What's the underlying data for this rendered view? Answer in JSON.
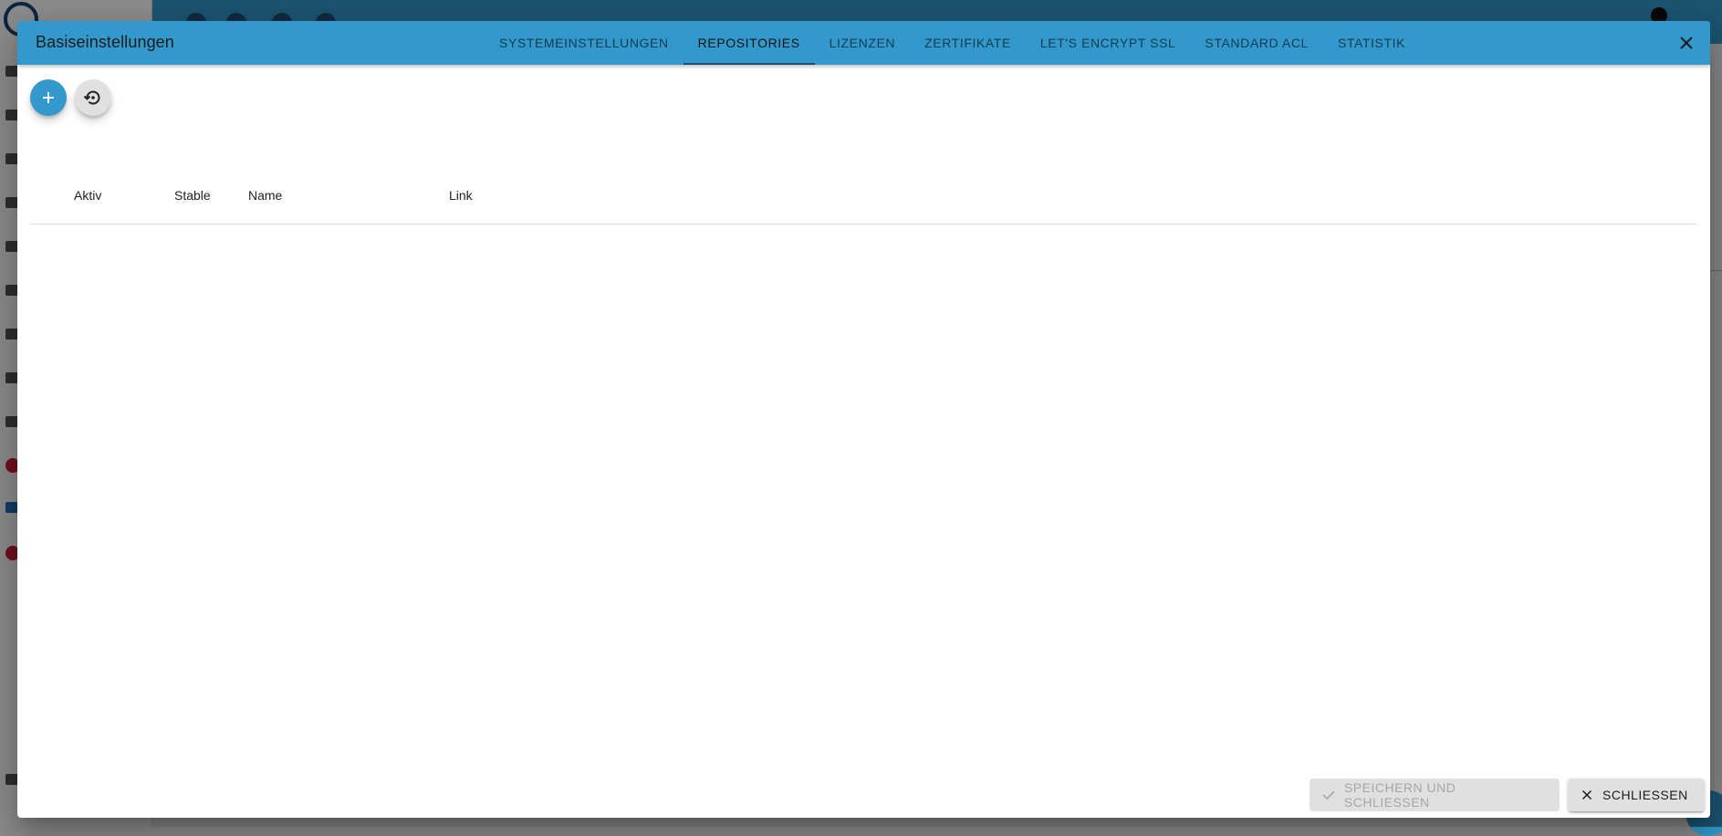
{
  "dialog": {
    "title": "Basiseinstellungen",
    "tabs": [
      {
        "label": "SYSTEMEINSTELLUNGEN"
      },
      {
        "label": "REPOSITORIES"
      },
      {
        "label": "LIZENZEN"
      },
      {
        "label": "ZERTIFIKATE"
      },
      {
        "label": "LET'S ENCRYPT SSL"
      },
      {
        "label": "STANDARD ACL"
      },
      {
        "label": "STATISTIK"
      }
    ],
    "active_tab": "REPOSITORIES",
    "accent_color": "#3399cc"
  },
  "table": {
    "columns": [
      "Aktiv",
      "Stable",
      "Name",
      "Link"
    ],
    "rows": []
  },
  "footer": {
    "save_label": "SPEICHERN UND SCHLIESSEN",
    "close_label": "SCHLIESSEN"
  },
  "icons": {
    "add": "plus-icon",
    "restore": "restore-icon",
    "close": "close-icon",
    "save": "check-icon"
  }
}
